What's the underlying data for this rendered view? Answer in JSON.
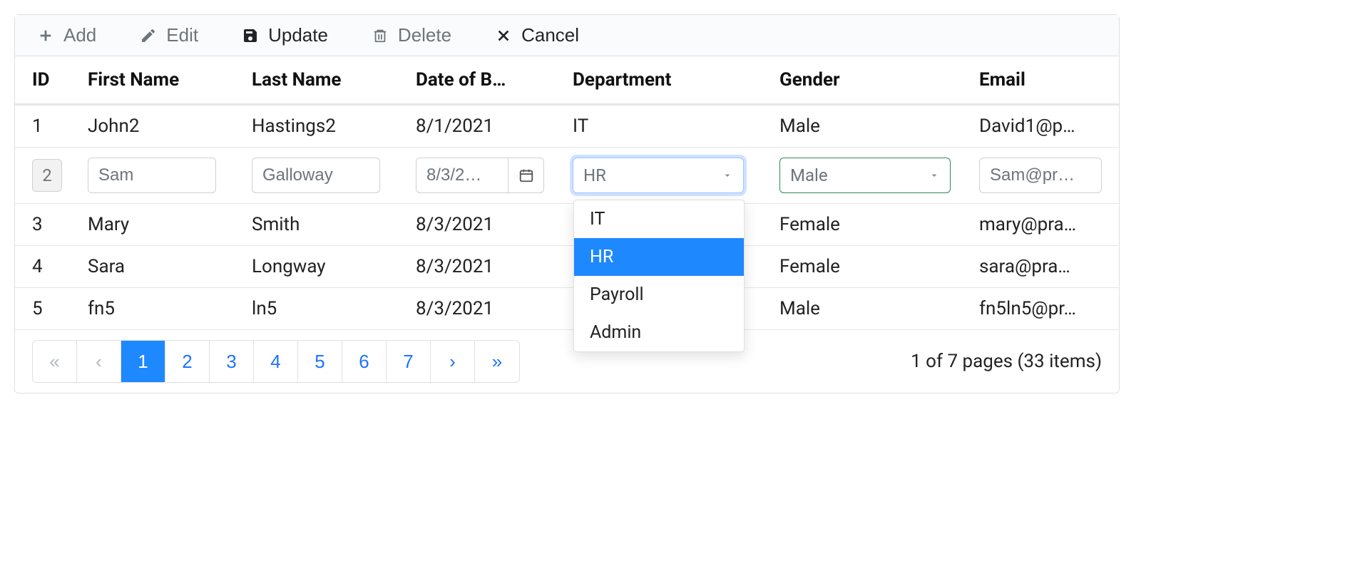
{
  "toolbar": {
    "add_label": "Add",
    "edit_label": "Edit",
    "update_label": "Update",
    "delete_label": "Delete",
    "cancel_label": "Cancel"
  },
  "columns": {
    "id": "ID",
    "first_name": "First Name",
    "last_name": "Last Name",
    "dob": "Date of B…",
    "department": "Department",
    "gender": "Gender",
    "email": "Email"
  },
  "rows": [
    {
      "id": "1",
      "first_name": "John2",
      "last_name": "Hastings2",
      "dob": "8/1/2021",
      "department": "IT",
      "gender": "Male",
      "email": "David1@p…"
    },
    {
      "id": "2",
      "first_name": "Sam",
      "last_name": "Galloway",
      "dob": "8/3/2…",
      "department": "HR",
      "gender": "Male",
      "email": "Sam@pr…"
    },
    {
      "id": "3",
      "first_name": "Mary",
      "last_name": "Smith",
      "dob": "8/3/2021",
      "department": "",
      "gender": "Female",
      "email": "mary@pra…"
    },
    {
      "id": "4",
      "first_name": "Sara",
      "last_name": "Longway",
      "dob": "8/3/2021",
      "department": "",
      "gender": "Female",
      "email": "sara@pra…"
    },
    {
      "id": "5",
      "first_name": "fn5",
      "last_name": "ln5",
      "dob": "8/3/2021",
      "department": "",
      "gender": "Male",
      "email": "fn5ln5@pr…"
    }
  ],
  "edit_row_index": 1,
  "department_options": [
    "IT",
    "HR",
    "Payroll",
    "Admin"
  ],
  "department_selected": "HR",
  "pager": {
    "pages": [
      "1",
      "2",
      "3",
      "4",
      "5",
      "6",
      "7"
    ],
    "active": "1",
    "info": "1 of 7 pages (33 items)"
  }
}
